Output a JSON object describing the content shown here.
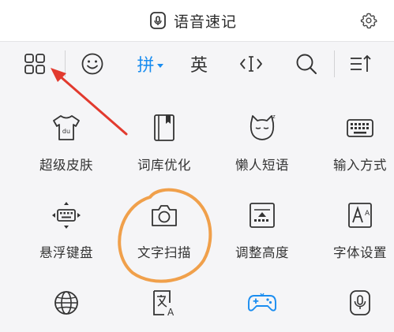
{
  "header": {
    "title": "语音速记",
    "title_icon": "voice-memo-icon",
    "settings_icon": "gear-icon"
  },
  "toolbar": {
    "items": [
      {
        "icon": "grid-menu-icon"
      },
      {
        "icon": "emoji-icon"
      },
      {
        "label": "拼"
      },
      {
        "label": "英"
      },
      {
        "icon": "cursor-edit-icon"
      },
      {
        "icon": "search-icon"
      },
      {
        "icon": "collapse-keyboard-icon"
      }
    ]
  },
  "grid": {
    "items": [
      {
        "label": "超级皮肤",
        "icon": "tshirt-skin-icon"
      },
      {
        "label": "词库优化",
        "icon": "book-dictionary-icon"
      },
      {
        "label": "懒人短语",
        "icon": "sleepy-cat-icon"
      },
      {
        "label": "输入方式",
        "icon": "keyboard-icon"
      },
      {
        "label": "悬浮键盘",
        "icon": "floating-keyboard-icon"
      },
      {
        "label": "文字扫描",
        "icon": "camera-icon"
      },
      {
        "label": "调整高度",
        "icon": "adjust-height-icon"
      },
      {
        "label": "字体设置",
        "icon": "font-icon"
      },
      {
        "label": "",
        "icon": "globe-icon"
      },
      {
        "label": "",
        "icon": "translate-icon"
      },
      {
        "label": "",
        "icon": "gamepad-icon"
      },
      {
        "label": "",
        "icon": "microphone-icon"
      }
    ]
  },
  "colors": {
    "accent": "#1a8df0",
    "annotation_arrow": "#e23a2e",
    "annotation_circle": "#f0a04b"
  }
}
